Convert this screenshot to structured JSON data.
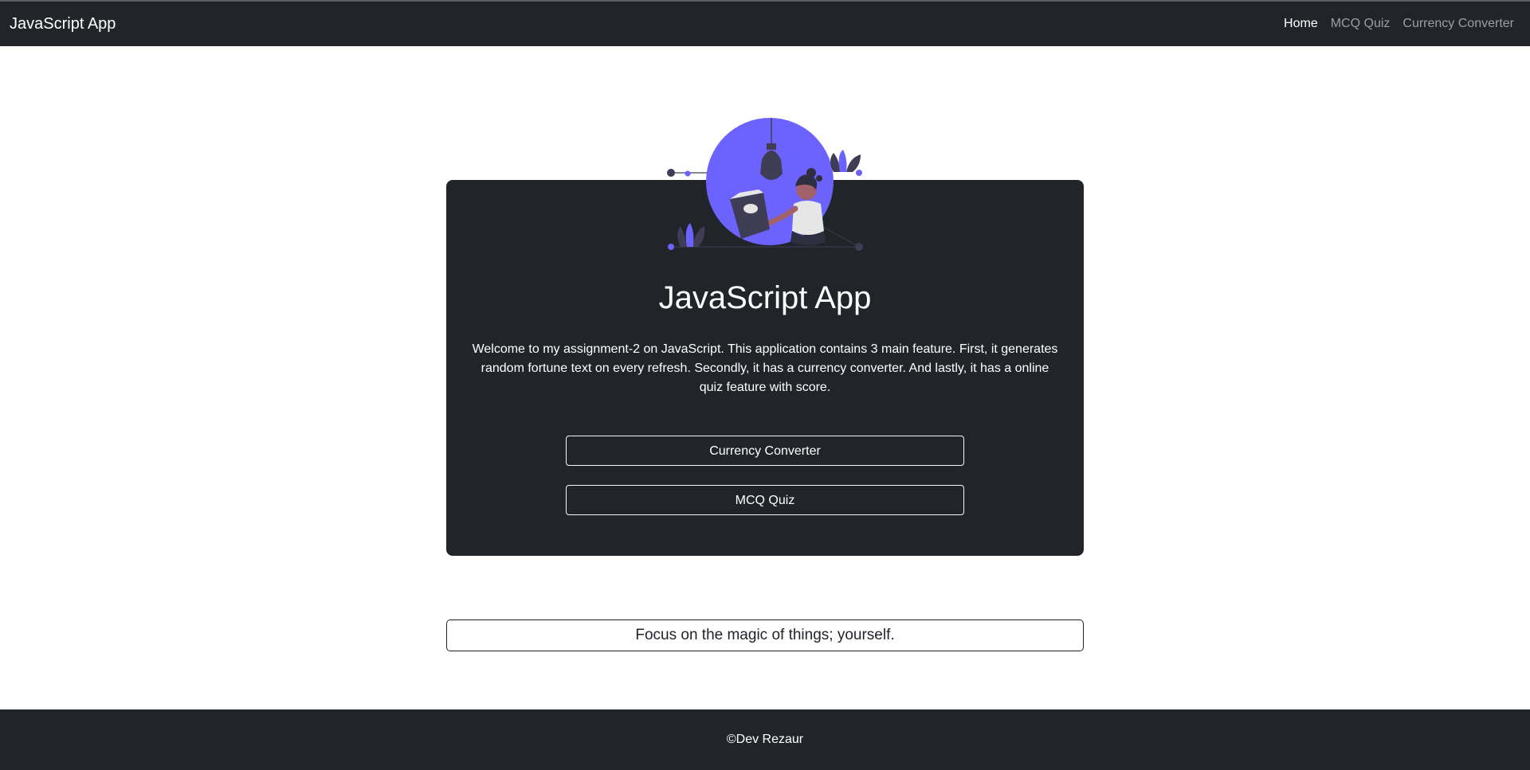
{
  "navbar": {
    "brand": "JavaScript App",
    "links": [
      {
        "label": "Home",
        "active": true
      },
      {
        "label": "MCQ Quiz",
        "active": false
      },
      {
        "label": "Currency Converter",
        "active": false
      }
    ]
  },
  "hero": {
    "title": "JavaScript App",
    "description": "Welcome to my assignment-2 on JavaScript. This application contains 3 main feature. First, it generates random fortune text on every refresh. Secondly, it has a currency converter. And lastly, it has a online quiz feature with score.",
    "buttons": [
      {
        "label": "Currency Converter"
      },
      {
        "label": "MCQ Quiz"
      }
    ],
    "illustration": "woman-reading-lightbulb-illustration"
  },
  "fortune": {
    "text": "Focus on the magic of things; yourself."
  },
  "footer": {
    "text": "©Dev Rezaur"
  },
  "colors": {
    "dark": "#212529",
    "accent": "#6c63ff",
    "white": "#ffffff",
    "muted_nav": "rgba(255,255,255,0.55)"
  }
}
